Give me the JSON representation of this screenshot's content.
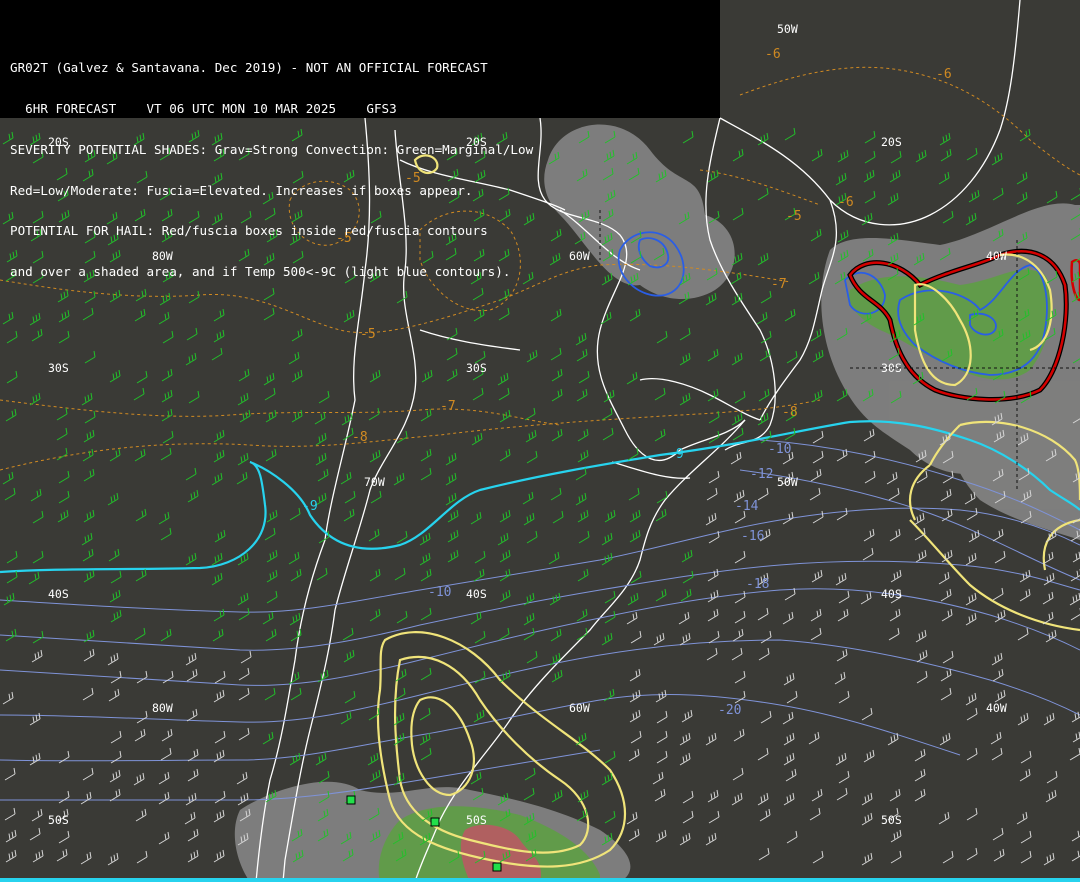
{
  "header": {
    "line1": "GR02T (Galvez & Santavana. Dec 2019) - NOT AN OFFICIAL FORECAST",
    "line2": "  6HR FORECAST    VT 06 UTC MON 10 MAR 2025    GFS3",
    "line3": "SEVERITY POTENTIAL SHADES: Grav=Strong Convection: Green=Marginal/Low",
    "line4": "Red=Low/Moderate: Fuscia=Elevated. Increases if boxes appear.",
    "line5": "POTENTIAL FOR HAIL: Red/fuscia boxes inside red/fuscia contours",
    "line6": "and over a shaded area, and if Temp 500<-9C (light blue contours)."
  },
  "grid_labels": {
    "lat20_w": "20S",
    "lat20_c": "20S",
    "lat20_e": "20S",
    "lat30_w": "30S",
    "lat30_c": "30S",
    "lat30_e": "30S",
    "lat40_w": "40S",
    "lat40_c": "40S",
    "lat40_e": "40S",
    "lat50_w": "50S",
    "lat50_c": "50S",
    "lat50_e": "50S",
    "lon80_n": "80W",
    "lon60_n": "60W",
    "lon40_n": "40W",
    "lon50_n": "50W",
    "lon70_m": "70W",
    "lon50_m": "50W",
    "lon80_s": "80W",
    "lon60_s": "60W",
    "lon40_s": "40W"
  },
  "contour_values": {
    "orange": [
      "-6",
      "-6",
      "-5",
      "-5",
      "-6",
      "-5",
      "-5",
      "-7",
      "-7",
      "-8",
      "-8"
    ],
    "cyan": [
      "-9",
      "-9"
    ],
    "blue": [
      "-10",
      "-12",
      "-14",
      "-16",
      "-18",
      "-10",
      "-20"
    ]
  },
  "colors": {
    "background": "#3a3a36",
    "coast": "#ffffff",
    "wind_barbs_warm": "#22c02a",
    "wind_barbs_cold": "#d6d6d6",
    "temp_500_cold": "#7f93d8",
    "temp_500_minus9": "#27d3ee",
    "temp_500_warm": "#d08a22",
    "shade_strong": "#8a8a8a",
    "shade_marginal": "#5e9e45",
    "shade_moderate": "#b06060",
    "contour_yellow": "#f0e47a",
    "contour_red": "#d40000"
  }
}
